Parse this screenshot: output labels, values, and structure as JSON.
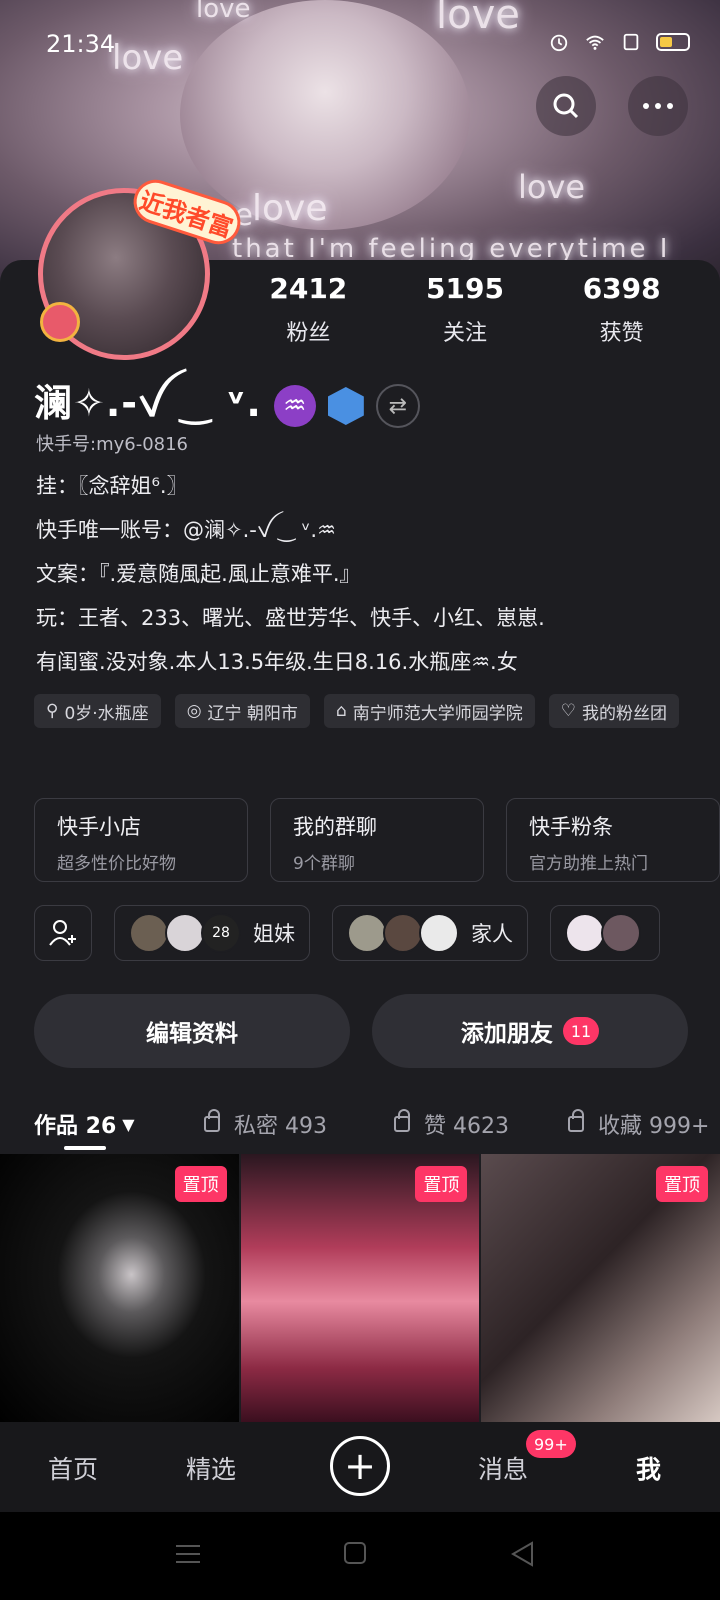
{
  "status": {
    "time": "21:34"
  },
  "header_bg_words": [
    "love",
    "love",
    "love",
    "love",
    "love",
    "love",
    "that I'm feeling everytime I"
  ],
  "avatar": {
    "badge": "近我者富"
  },
  "stats": [
    {
      "num": "2412",
      "label": "粉丝"
    },
    {
      "num": "5195",
      "label": "关注"
    },
    {
      "num": "6398",
      "label": "获赞"
    }
  ],
  "profile": {
    "username": "澜✧.-ꪜ ‿ ᵛ.",
    "zodiac_symbol": "♒",
    "kuaishou_id": "快手号:my6-0816",
    "bio": [
      "挂：〖念辞姐⁶.〗",
      "快手唯一账号：@澜✧.-ꪜ ‿ ᵛ.♒",
      "文案：『.爱意随風起.風止意难平.』",
      "玩：王者、233、曙光、盛世芳华、快手、小红、崽崽.",
      "有闺蜜.没对象.本人13.5年级.生日8.16.水瓶座♒.女"
    ]
  },
  "tags": [
    {
      "icon": "gender-icon",
      "label": "0岁·水瓶座"
    },
    {
      "icon": "location-icon",
      "label": "辽宁 朝阳市"
    },
    {
      "icon": "school-icon",
      "label": "南宁师范大学师园学院"
    },
    {
      "icon": "heart-icon",
      "label": "我的粉丝团"
    }
  ],
  "cards": [
    {
      "title": "快手小店",
      "sub": "超多性价比好物"
    },
    {
      "title": "我的群聊",
      "sub": "9个群聊"
    },
    {
      "title": "快手粉条",
      "sub": "官方助推上热门"
    }
  ],
  "groups": [
    {
      "name": "姐妹",
      "count": "28"
    },
    {
      "name": "家人",
      "count": ""
    },
    {
      "name": "",
      "count": ""
    }
  ],
  "actions": {
    "edit": "编辑资料",
    "add_friend": "添加朋友",
    "add_friend_badge": "11"
  },
  "tabs": [
    {
      "label": "作品 26",
      "active": true
    },
    {
      "label": "私密 493"
    },
    {
      "label": "赞 4623"
    },
    {
      "label": "收藏 999+"
    }
  ],
  "grid": [
    {
      "badge": "置顶"
    },
    {
      "badge": "置顶"
    },
    {
      "badge": "置顶"
    }
  ],
  "nav": {
    "home": "首页",
    "featured": "精选",
    "messages": "消息",
    "me": "我",
    "msg_badge": "99+"
  },
  "colors": {
    "accent": "#fe3666",
    "bg": "#1d1d21",
    "zodiac": "#8c3fc6"
  }
}
